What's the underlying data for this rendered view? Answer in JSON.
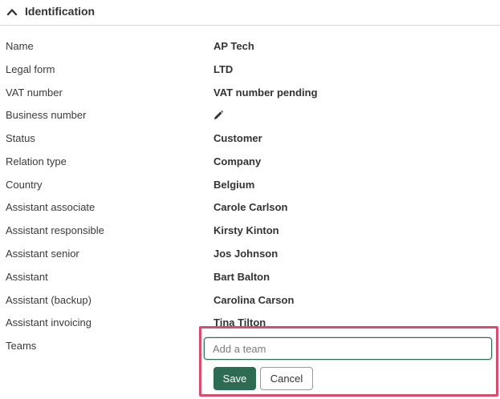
{
  "section": {
    "title": "Identification",
    "collapse_icon": "chevron-up-icon"
  },
  "fields": [
    {
      "label": "Name",
      "value": "AP Tech"
    },
    {
      "label": "Legal form",
      "value": "LTD"
    },
    {
      "label": "VAT number",
      "value": "VAT number pending"
    },
    {
      "label": "Business number",
      "value": "",
      "icon": "pencil-icon"
    },
    {
      "label": "Status",
      "value": "Customer"
    },
    {
      "label": "Relation type",
      "value": "Company"
    },
    {
      "label": "Country",
      "value": "Belgium"
    },
    {
      "label": "Assistant associate",
      "value": "Carole Carlson"
    },
    {
      "label": "Assistant responsible",
      "value": "Kirsty Kinton"
    },
    {
      "label": "Assistant senior",
      "value": "Jos Johnson"
    },
    {
      "label": "Assistant",
      "value": "Bart Balton"
    },
    {
      "label": "Assistant (backup)",
      "value": "Carolina Carson"
    },
    {
      "label": "Assistant invoicing",
      "value": "Tina Tilton"
    },
    {
      "label": "Teams",
      "value": ""
    }
  ],
  "teams_editor": {
    "input_value": "",
    "input_placeholder": "Add a team",
    "save_label": "Save",
    "cancel_label": "Cancel",
    "highlight_color": "#d64d6f",
    "accent_color": "#2e6b53"
  }
}
